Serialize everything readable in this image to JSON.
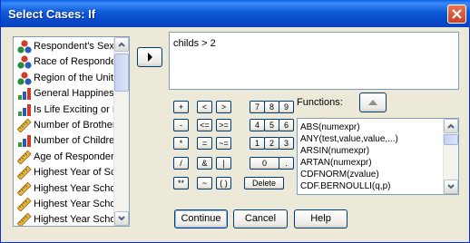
{
  "window": {
    "title": "Select Cases: If"
  },
  "variables": {
    "items": [
      {
        "label": "Respondent's Sex",
        "icon": "nominal-icon"
      },
      {
        "label": "Race of Responde",
        "icon": "nominal-icon"
      },
      {
        "label": "Region of the Unite",
        "icon": "nominal-icon"
      },
      {
        "label": "General Happiness",
        "icon": "ordinal-icon"
      },
      {
        "label": "Is Life Exciting or D",
        "icon": "ordinal-icon"
      },
      {
        "label": "Number of Brothers",
        "icon": "scale-icon"
      },
      {
        "label": "Number of Children",
        "icon": "ordinal-icon"
      },
      {
        "label": "Age of Responder",
        "icon": "scale-icon"
      },
      {
        "label": "Highest Year of Sc",
        "icon": "scale-icon"
      },
      {
        "label": "Highest Year Scho",
        "icon": "scale-icon"
      },
      {
        "label": "Highest Year Scho",
        "icon": "scale-icon"
      },
      {
        "label": "Highest Year Scho",
        "icon": "scale-icon"
      }
    ]
  },
  "expression": {
    "value": "childs > 2"
  },
  "keypad": {
    "row1": [
      "+",
      "<",
      ">",
      "7",
      "8",
      "9"
    ],
    "row2": [
      "-",
      "<=",
      ">=",
      "4",
      "5",
      "6"
    ],
    "row3": [
      "*",
      "=",
      "~=",
      "1",
      "2",
      "3"
    ],
    "row4": [
      "/",
      "&",
      "|",
      "0",
      "."
    ],
    "row5": [
      "**",
      "~",
      "( )",
      "Delete"
    ]
  },
  "functions": {
    "label": "Functions:",
    "items": [
      "ABS(numexpr)",
      "ANY(test,value,value,...)",
      "ARSIN(numexpr)",
      "ARTAN(numexpr)",
      "CDFNORM(zvalue)",
      "CDF.BERNOULLI(q,p)"
    ]
  },
  "buttons": {
    "continue": "Continue",
    "cancel": "Cancel",
    "help": "Help"
  },
  "colors": {
    "titlebar": "#0a5fe8",
    "dialog_bg": "#ece9d8",
    "close": "#d85a3a"
  }
}
